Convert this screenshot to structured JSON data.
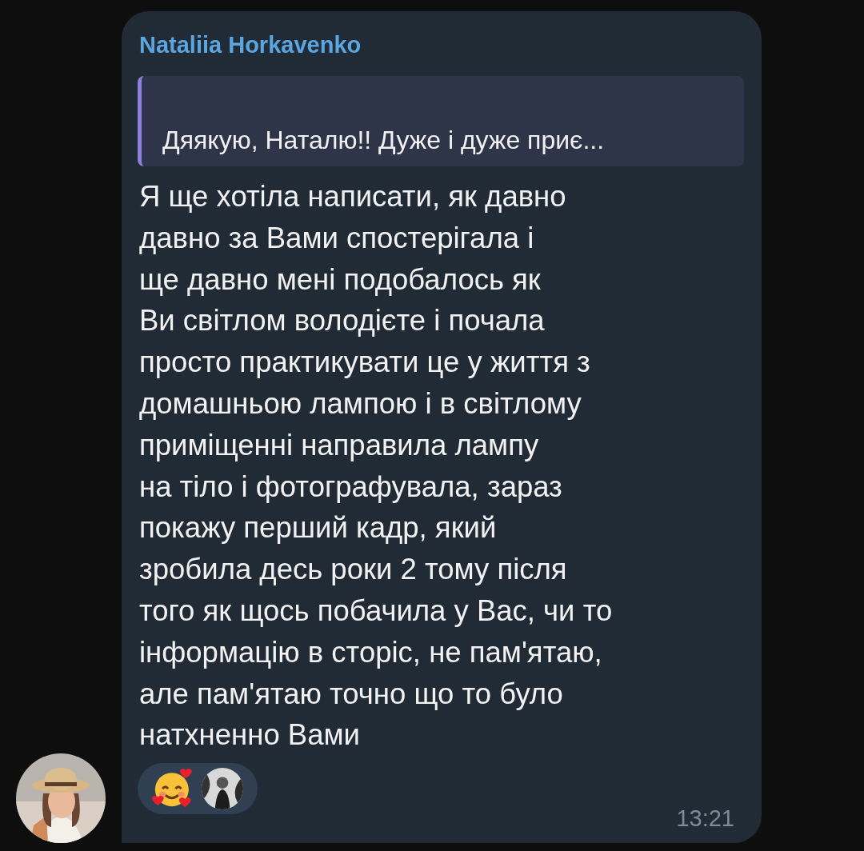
{
  "message": {
    "sender": "Nataliia Horkavenko",
    "reply_quote": "Дяякую, Наталю!! Дуже і дуже приє...",
    "text": "Я ще хотіла написати, як давно\nдавно за Вами спостерігала і\nще давно мені подобалось як\nВи світлом володієте і почала\nпросто практикувати це у життя з\nдомашньою лампою і в світлому\nприміщенні направила лампу\nна тіло і фотографувала, зараз\nпокажу перший кадр, який\nзробила десь роки 2 тому після\nтого як щось побачила у Вас, чи то\nінформацію в сторіс, не пам'ятаю,\nале пам'ятаю точно що то було\nнатхненно Вами",
    "reactions": [
      {
        "kind": "emoji"
      }
    ],
    "time": "13:21"
  }
}
